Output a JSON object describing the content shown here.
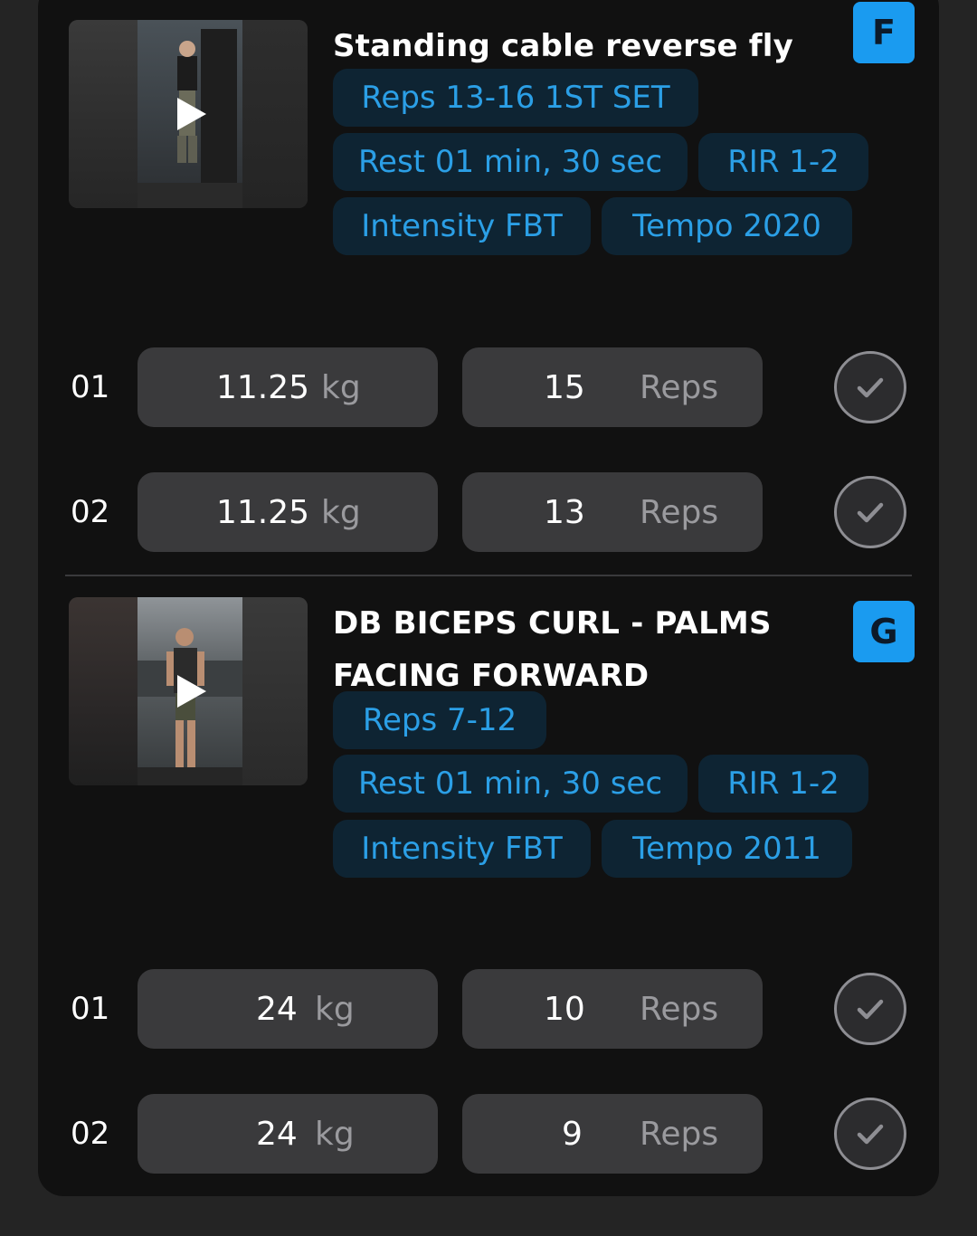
{
  "exercises": [
    {
      "title_lines": [
        "Standing cable reverse fly"
      ],
      "letter": "F",
      "chips": {
        "reps": "Reps 13-16 1ST SET",
        "rest": "Rest 01 min, 30 sec",
        "rir": "RIR 1-2",
        "intensity": "Intensity FBT",
        "tempo": "Tempo 2020"
      },
      "sets": [
        {
          "num": "01",
          "weight": "11.25",
          "weight_unit": "kg",
          "reps": "15",
          "reps_unit": "Reps"
        },
        {
          "num": "02",
          "weight": "11.25",
          "weight_unit": "kg",
          "reps": "13",
          "reps_unit": "Reps"
        }
      ]
    },
    {
      "title_lines": [
        "DB BICEPS CURL - PALMS",
        "FACING FORWARD"
      ],
      "letter": "G",
      "chips": {
        "reps": "Reps 7-12",
        "rest": "Rest 01 min, 30 sec",
        "rir": "RIR 1-2",
        "intensity": "Intensity FBT",
        "tempo": "Tempo 2011"
      },
      "sets": [
        {
          "num": "01",
          "weight": "24",
          "weight_unit": "kg",
          "reps": "10",
          "reps_unit": "Reps"
        },
        {
          "num": "02",
          "weight": "24",
          "weight_unit": "kg",
          "reps": "9",
          "reps_unit": "Reps"
        }
      ]
    }
  ],
  "icons": {
    "play": "play-icon",
    "check": "checkmark-icon"
  },
  "colors": {
    "accent": "#1a9bf0",
    "chip_bg": "#0e2433",
    "chip_text": "#2b9fe6",
    "card_bg": "#111111",
    "field_bg": "#3a3a3c"
  }
}
